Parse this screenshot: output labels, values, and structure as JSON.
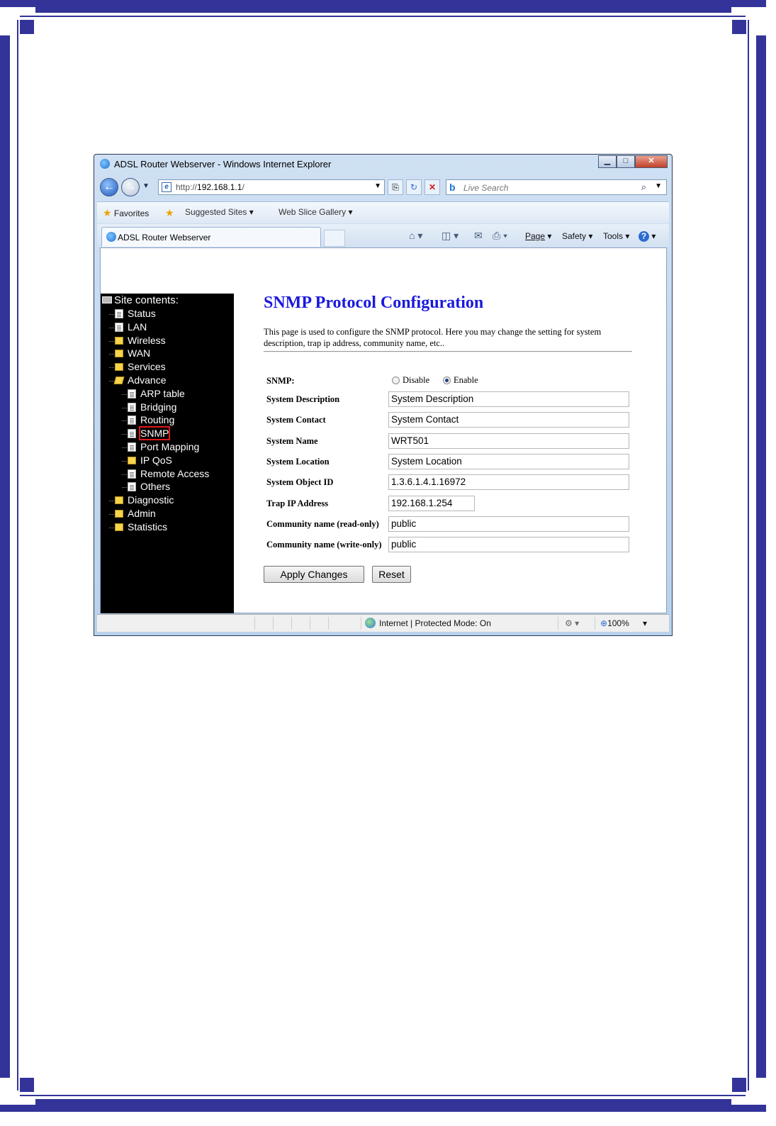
{
  "window": {
    "title": "ADSL Router Webserver - Windows Internet Explorer",
    "controls": {
      "minimize": "▁",
      "maximize": "□",
      "close": "✕"
    }
  },
  "address_bar": {
    "url_prefix": "http://",
    "url_host": "192.168.1.1",
    "url_suffix": "/",
    "search_placeholder": "Live Search"
  },
  "favorites_bar": {
    "favorites_label": "Favorites",
    "suggested_sites": "Suggested Sites",
    "web_slice_gallery": "Web Slice Gallery"
  },
  "tab": {
    "label": "ADSL Router Webserver"
  },
  "command_bar": {
    "page": "Page",
    "safety": "Safety",
    "tools": "Tools",
    "help": "?"
  },
  "sidebar": {
    "header": "Site contents:",
    "items": [
      {
        "label": "Status",
        "icon": "document-icon",
        "level": 1
      },
      {
        "label": "LAN",
        "icon": "document-icon",
        "level": 1
      },
      {
        "label": "Wireless",
        "icon": "folder-icon",
        "level": 1
      },
      {
        "label": "WAN",
        "icon": "folder-icon",
        "level": 1
      },
      {
        "label": "Services",
        "icon": "folder-icon",
        "level": 1
      },
      {
        "label": "Advance",
        "icon": "folder-open-icon",
        "level": 1
      },
      {
        "label": "ARP table",
        "icon": "document-icon",
        "level": 2
      },
      {
        "label": "Bridging",
        "icon": "document-icon",
        "level": 2
      },
      {
        "label": "Routing",
        "icon": "document-icon",
        "level": 2
      },
      {
        "label": "SNMP",
        "icon": "document-icon",
        "level": 2,
        "highlighted": true
      },
      {
        "label": "Port Mapping",
        "icon": "document-icon",
        "level": 2
      },
      {
        "label": "IP QoS",
        "icon": "folder-icon",
        "level": 2
      },
      {
        "label": "Remote Access",
        "icon": "document-icon",
        "level": 2
      },
      {
        "label": "Others",
        "icon": "document-icon",
        "level": 2
      },
      {
        "label": "Diagnostic",
        "icon": "folder-icon",
        "level": 1
      },
      {
        "label": "Admin",
        "icon": "folder-icon",
        "level": 1
      },
      {
        "label": "Statistics",
        "icon": "folder-icon",
        "level": 1
      }
    ]
  },
  "main": {
    "title": "SNMP Protocol Configuration",
    "description": "This page is used to configure the SNMP protocol. Here you may change the setting for system description, trap ip address, community name, etc..",
    "snmp": {
      "label": "SNMP:",
      "disable": "Disable",
      "enable": "Enable",
      "selected": "Enable"
    },
    "fields": [
      {
        "label": "System Description",
        "value": "System Description"
      },
      {
        "label": "System Contact",
        "value": "System Contact"
      },
      {
        "label": "System Name",
        "value": "WRT501"
      },
      {
        "label": "System Location",
        "value": "System Location"
      },
      {
        "label": "System Object ID",
        "value": "1.3.6.1.4.1.16972"
      },
      {
        "label": "Trap IP Address",
        "value": "192.168.1.254"
      },
      {
        "label": "Community name (read-only)",
        "value": "public"
      },
      {
        "label": "Community name (write-only)",
        "value": "public"
      }
    ],
    "apply_label": "Apply Changes",
    "reset_label": "Reset"
  },
  "status_bar": {
    "zone": "Internet | Protected Mode: On",
    "zoom": "100%"
  },
  "colors": {
    "frame": "#33339a",
    "title_blue": "#1a1adb",
    "highlight": "#e01818"
  }
}
